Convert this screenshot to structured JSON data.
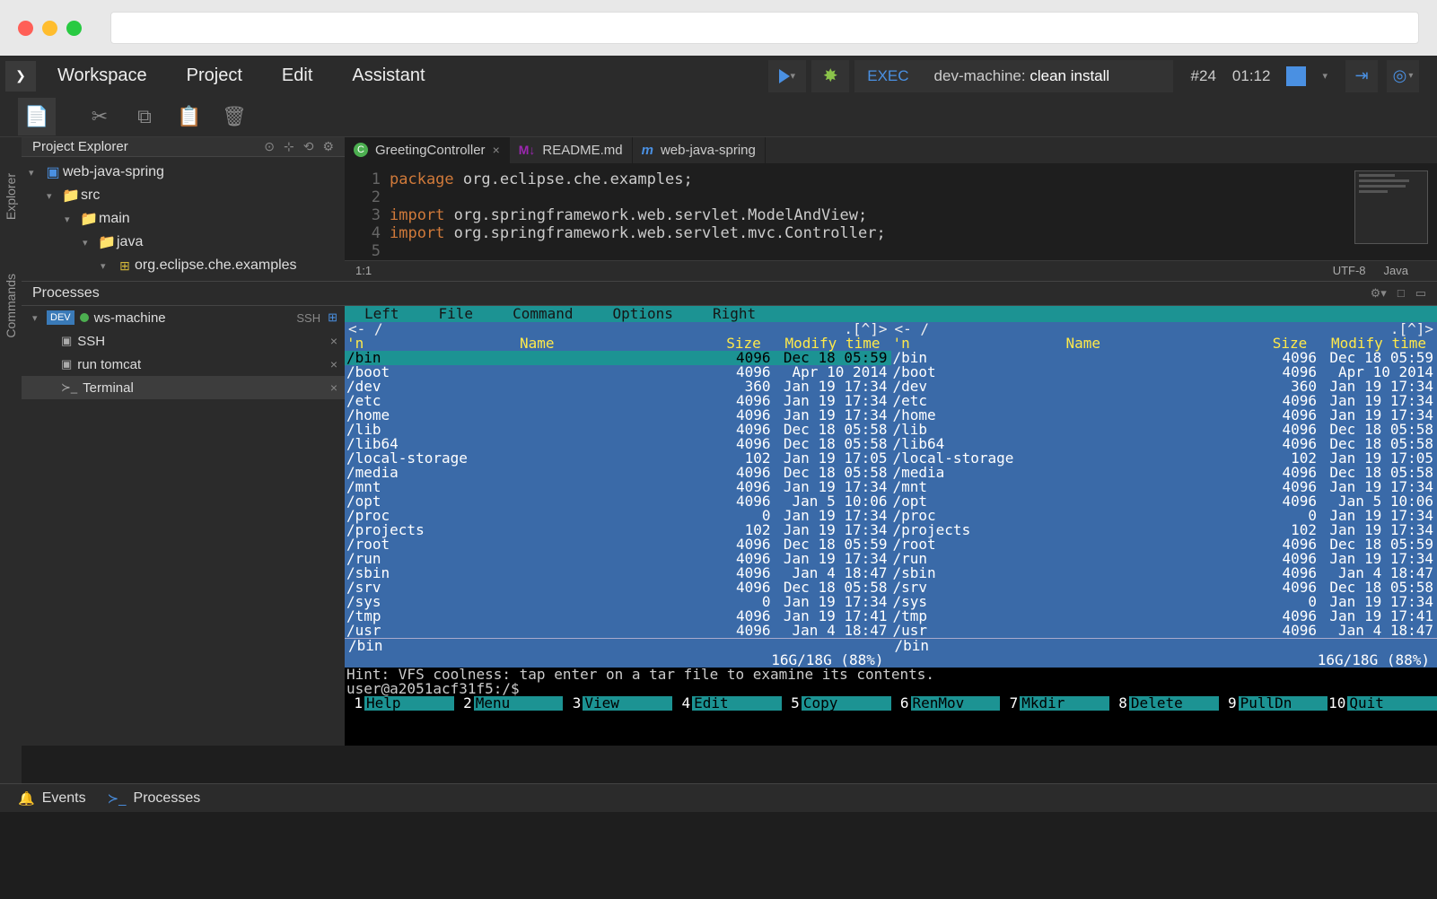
{
  "menu": {
    "workspace": "Workspace",
    "project": "Project",
    "edit": "Edit",
    "assistant": "Assistant"
  },
  "exec": {
    "label": "EXEC",
    "machine": "dev-machine:",
    "command": "clean install",
    "run_id": "#24",
    "time": "01:12"
  },
  "panels": {
    "explorer_rail": "Explorer",
    "commands_rail": "Commands",
    "project_explorer": "Project Explorer",
    "processes": "Processes"
  },
  "tree": {
    "root": "web-java-spring",
    "src": "src",
    "main": "main",
    "java": "java",
    "pkg": "org.eclipse.che.examples"
  },
  "tabs": {
    "t1": "GreetingController",
    "t2": "README.md",
    "t3": "web-java-spring"
  },
  "code": {
    "l1_kw": "package",
    "l1_txt": " org.eclipse.che.examples;",
    "l3_kw": "import",
    "l3_txt": " org.springframework.web.servlet.ModelAndView;",
    "l4_kw": "import",
    "l4_txt": " org.springframework.web.servlet.mvc.Controller;"
  },
  "status": {
    "pos": "1:1",
    "enc": "UTF-8",
    "lang": "Java"
  },
  "processes_tree": {
    "machine": "ws-machine",
    "machine_ssh": "SSH",
    "ssh": "SSH",
    "tomcat": "run tomcat",
    "terminal": "Terminal"
  },
  "mc": {
    "menu": {
      "left": "Left",
      "file": "File",
      "command": "Command",
      "options": "Options",
      "right": "Right"
    },
    "path": "<-  /",
    "path_suffix": ".[^]>",
    "header": {
      "n": "'n",
      "name": "Name",
      "size": "Size",
      "modify": "Modify time"
    },
    "rows": [
      {
        "name": "/bin",
        "size": "4096",
        "mod": "Dec 18 05:59"
      },
      {
        "name": "/boot",
        "size": "4096",
        "mod": "Apr 10  2014"
      },
      {
        "name": "/dev",
        "size": "360",
        "mod": "Jan 19 17:34"
      },
      {
        "name": "/etc",
        "size": "4096",
        "mod": "Jan 19 17:34"
      },
      {
        "name": "/home",
        "size": "4096",
        "mod": "Jan 19 17:34"
      },
      {
        "name": "/lib",
        "size": "4096",
        "mod": "Dec 18 05:58"
      },
      {
        "name": "/lib64",
        "size": "4096",
        "mod": "Dec 18 05:58"
      },
      {
        "name": "/local-storage",
        "size": "102",
        "mod": "Jan 19 17:05"
      },
      {
        "name": "/media",
        "size": "4096",
        "mod": "Dec 18 05:58"
      },
      {
        "name": "/mnt",
        "size": "4096",
        "mod": "Jan 19 17:34"
      },
      {
        "name": "/opt",
        "size": "4096",
        "mod": "Jan  5 10:06"
      },
      {
        "name": "/proc",
        "size": "0",
        "mod": "Jan 19 17:34"
      },
      {
        "name": "/projects",
        "size": "102",
        "mod": "Jan 19 17:34"
      },
      {
        "name": "/root",
        "size": "4096",
        "mod": "Dec 18 05:59"
      },
      {
        "name": "/run",
        "size": "4096",
        "mod": "Jan 19 17:34"
      },
      {
        "name": "/sbin",
        "size": "4096",
        "mod": "Jan  4 18:47"
      },
      {
        "name": "/srv",
        "size": "4096",
        "mod": "Dec 18 05:58"
      },
      {
        "name": "/sys",
        "size": "0",
        "mod": "Jan 19 17:34"
      },
      {
        "name": "/tmp",
        "size": "4096",
        "mod": "Jan 19 17:41"
      },
      {
        "name": "/usr",
        "size": "4096",
        "mod": "Jan  4 18:47"
      }
    ],
    "footer": "/bin",
    "stats": "16G/18G (88%)",
    "hint": "Hint: VFS coolness: tap enter on a tar file to examine its contents.",
    "prompt": "user@a2051acf31f5:/$",
    "keys": [
      {
        "n": "1",
        "l": "Help"
      },
      {
        "n": "2",
        "l": "Menu"
      },
      {
        "n": "3",
        "l": "View"
      },
      {
        "n": "4",
        "l": "Edit"
      },
      {
        "n": "5",
        "l": "Copy"
      },
      {
        "n": "6",
        "l": "RenMov"
      },
      {
        "n": "7",
        "l": "Mkdir"
      },
      {
        "n": "8",
        "l": "Delete"
      },
      {
        "n": "9",
        "l": "PullDn"
      },
      {
        "n": "10",
        "l": "Quit"
      }
    ]
  },
  "bottom": {
    "events": "Events",
    "processes": "Processes"
  }
}
